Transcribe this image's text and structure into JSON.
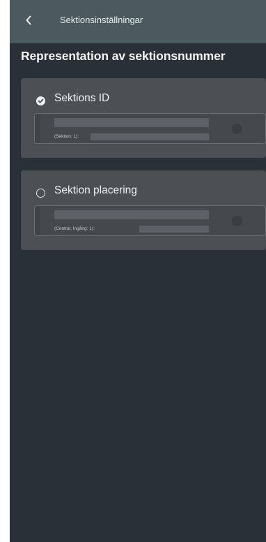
{
  "header": {
    "back_icon": "chevron-left-icon",
    "title": "Sektionsinställningar"
  },
  "heading": "Representation av sektionsnummer",
  "options": [
    {
      "label": "Sektions ID",
      "selected": true,
      "caption": "(Sektion: 1):"
    },
    {
      "label": "Sektion placering",
      "selected": false,
      "caption": "(Central, Ingång: 1):"
    }
  ],
  "colors": {
    "background": "#2a3038",
    "header": "#4b5a5f",
    "card": "#4b5055",
    "text": "#eef1f3"
  }
}
